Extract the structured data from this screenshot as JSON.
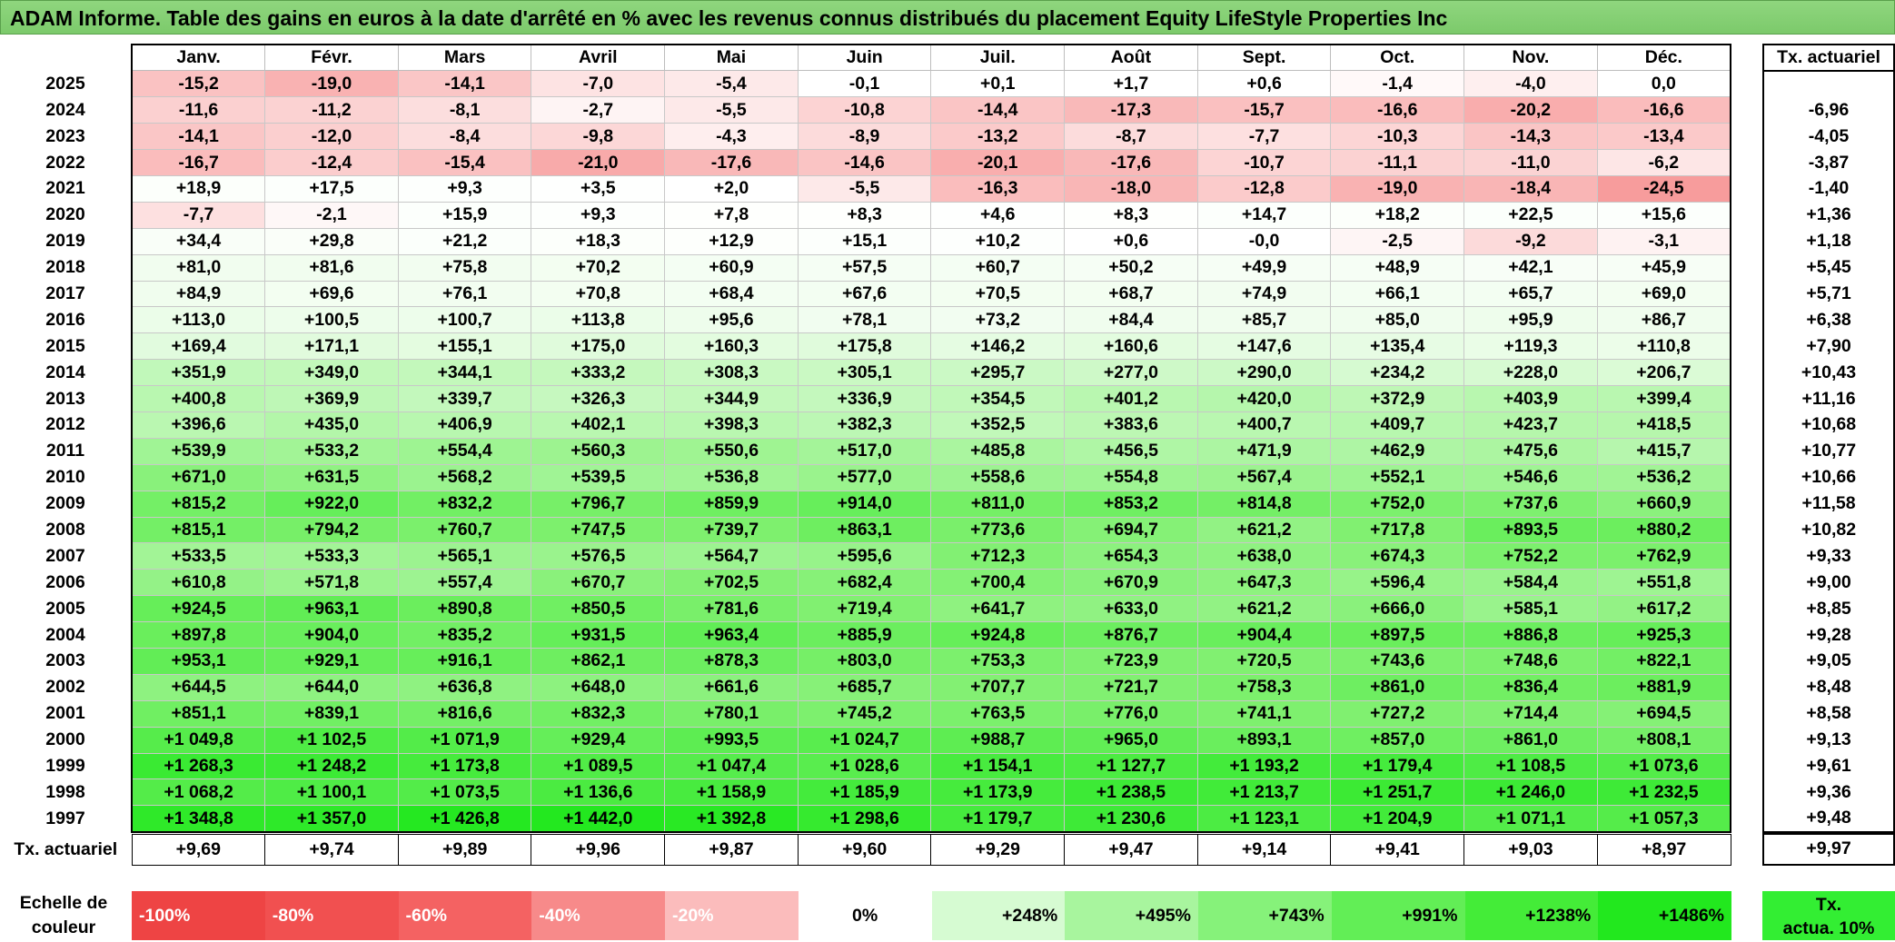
{
  "title": "ADAM Informe. Table des gains en euros à la date d'arrêté en % avec les revenus connus distribués du placement Equity LifeStyle Properties Inc",
  "months": [
    "Janv.",
    "Févr.",
    "Mars",
    "Avril",
    "Mai",
    "Juin",
    "Juil.",
    "Août",
    "Sept.",
    "Oct.",
    "Nov.",
    "Déc."
  ],
  "actuarial_header": "Tx. actuariel",
  "rows": [
    {
      "year": "2025",
      "values": [
        "-15,2",
        "-19,0",
        "-14,1",
        "-7,0",
        "-5,4",
        "-0,1",
        "+0,1",
        "+1,7",
        "+0,6",
        "-1,4",
        "-4,0",
        "0,0"
      ],
      "rate": ""
    },
    {
      "year": "2024",
      "values": [
        "-11,6",
        "-11,2",
        "-8,1",
        "-2,7",
        "-5,5",
        "-10,8",
        "-14,4",
        "-17,3",
        "-15,7",
        "-16,6",
        "-20,2",
        "-16,6"
      ],
      "rate": "-6,96"
    },
    {
      "year": "2023",
      "values": [
        "-14,1",
        "-12,0",
        "-8,4",
        "-9,8",
        "-4,3",
        "-8,9",
        "-13,2",
        "-8,7",
        "-7,7",
        "-10,3",
        "-14,3",
        "-13,4"
      ],
      "rate": "-4,05"
    },
    {
      "year": "2022",
      "values": [
        "-16,7",
        "-12,4",
        "-15,4",
        "-21,0",
        "-17,6",
        "-14,6",
        "-20,1",
        "-17,6",
        "-10,7",
        "-11,1",
        "-11,0",
        "-6,2"
      ],
      "rate": "-3,87"
    },
    {
      "year": "2021",
      "values": [
        "+18,9",
        "+17,5",
        "+9,3",
        "+3,5",
        "+2,0",
        "-5,5",
        "-16,3",
        "-18,0",
        "-12,8",
        "-19,0",
        "-18,4",
        "-24,5"
      ],
      "rate": "-1,40"
    },
    {
      "year": "2020",
      "values": [
        "-7,7",
        "-2,1",
        "+15,9",
        "+9,3",
        "+7,8",
        "+8,3",
        "+4,6",
        "+8,3",
        "+14,7",
        "+18,2",
        "+22,5",
        "+15,6"
      ],
      "rate": "+1,36"
    },
    {
      "year": "2019",
      "values": [
        "+34,4",
        "+29,8",
        "+21,2",
        "+18,3",
        "+12,9",
        "+15,1",
        "+10,2",
        "+0,6",
        "-0,0",
        "-2,5",
        "-9,2",
        "-3,1"
      ],
      "rate": "+1,18"
    },
    {
      "year": "2018",
      "values": [
        "+81,0",
        "+81,6",
        "+75,8",
        "+70,2",
        "+60,9",
        "+57,5",
        "+60,7",
        "+50,2",
        "+49,9",
        "+48,9",
        "+42,1",
        "+45,9"
      ],
      "rate": "+5,45"
    },
    {
      "year": "2017",
      "values": [
        "+84,9",
        "+69,6",
        "+76,1",
        "+70,8",
        "+68,4",
        "+67,6",
        "+70,5",
        "+68,7",
        "+74,9",
        "+66,1",
        "+65,7",
        "+69,0"
      ],
      "rate": "+5,71"
    },
    {
      "year": "2016",
      "values": [
        "+113,0",
        "+100,5",
        "+100,7",
        "+113,8",
        "+95,6",
        "+78,1",
        "+73,2",
        "+84,4",
        "+85,7",
        "+85,0",
        "+95,9",
        "+86,7"
      ],
      "rate": "+6,38"
    },
    {
      "year": "2015",
      "values": [
        "+169,4",
        "+171,1",
        "+155,1",
        "+175,0",
        "+160,3",
        "+175,8",
        "+146,2",
        "+160,6",
        "+147,6",
        "+135,4",
        "+119,3",
        "+110,8"
      ],
      "rate": "+7,90"
    },
    {
      "year": "2014",
      "values": [
        "+351,9",
        "+349,0",
        "+344,1",
        "+333,2",
        "+308,3",
        "+305,1",
        "+295,7",
        "+277,0",
        "+290,0",
        "+234,2",
        "+228,0",
        "+206,7"
      ],
      "rate": "+10,43"
    },
    {
      "year": "2013",
      "values": [
        "+400,8",
        "+369,9",
        "+339,7",
        "+326,3",
        "+344,9",
        "+336,9",
        "+354,5",
        "+401,2",
        "+420,0",
        "+372,9",
        "+403,9",
        "+399,4"
      ],
      "rate": "+11,16"
    },
    {
      "year": "2012",
      "values": [
        "+396,6",
        "+435,0",
        "+406,9",
        "+402,1",
        "+398,3",
        "+382,3",
        "+352,5",
        "+383,6",
        "+400,7",
        "+409,7",
        "+423,7",
        "+418,5"
      ],
      "rate": "+10,68"
    },
    {
      "year": "2011",
      "values": [
        "+539,9",
        "+533,2",
        "+554,4",
        "+560,3",
        "+550,6",
        "+517,0",
        "+485,8",
        "+456,5",
        "+471,9",
        "+462,9",
        "+475,6",
        "+415,7"
      ],
      "rate": "+10,77"
    },
    {
      "year": "2010",
      "values": [
        "+671,0",
        "+631,5",
        "+568,2",
        "+539,5",
        "+536,8",
        "+577,0",
        "+558,6",
        "+554,8",
        "+567,4",
        "+552,1",
        "+546,6",
        "+536,2"
      ],
      "rate": "+10,66"
    },
    {
      "year": "2009",
      "values": [
        "+815,2",
        "+922,0",
        "+832,2",
        "+796,7",
        "+859,9",
        "+914,0",
        "+811,0",
        "+853,2",
        "+814,8",
        "+752,0",
        "+737,6",
        "+660,9"
      ],
      "rate": "+11,58"
    },
    {
      "year": "2008",
      "values": [
        "+815,1",
        "+794,2",
        "+760,7",
        "+747,5",
        "+739,7",
        "+863,1",
        "+773,6",
        "+694,7",
        "+621,2",
        "+717,8",
        "+893,5",
        "+880,2"
      ],
      "rate": "+10,82"
    },
    {
      "year": "2007",
      "values": [
        "+533,5",
        "+533,3",
        "+565,1",
        "+576,5",
        "+564,7",
        "+595,6",
        "+712,3",
        "+654,3",
        "+638,0",
        "+674,3",
        "+752,2",
        "+762,9"
      ],
      "rate": "+9,33"
    },
    {
      "year": "2006",
      "values": [
        "+610,8",
        "+571,8",
        "+557,4",
        "+670,7",
        "+702,5",
        "+682,4",
        "+700,4",
        "+670,9",
        "+647,3",
        "+596,4",
        "+584,4",
        "+551,8"
      ],
      "rate": "+9,00"
    },
    {
      "year": "2005",
      "values": [
        "+924,5",
        "+963,1",
        "+890,8",
        "+850,5",
        "+781,6",
        "+719,4",
        "+641,7",
        "+633,0",
        "+621,2",
        "+666,0",
        "+585,1",
        "+617,2"
      ],
      "rate": "+8,85"
    },
    {
      "year": "2004",
      "values": [
        "+897,8",
        "+904,0",
        "+835,2",
        "+931,5",
        "+963,4",
        "+885,9",
        "+924,8",
        "+876,7",
        "+904,4",
        "+897,5",
        "+886,8",
        "+925,3"
      ],
      "rate": "+9,28"
    },
    {
      "year": "2003",
      "values": [
        "+953,1",
        "+929,1",
        "+916,1",
        "+862,1",
        "+878,3",
        "+803,0",
        "+753,3",
        "+723,9",
        "+720,5",
        "+743,6",
        "+748,6",
        "+822,1"
      ],
      "rate": "+9,05"
    },
    {
      "year": "2002",
      "values": [
        "+644,5",
        "+644,0",
        "+636,8",
        "+648,0",
        "+661,6",
        "+685,7",
        "+707,7",
        "+721,7",
        "+758,3",
        "+861,0",
        "+836,4",
        "+881,9"
      ],
      "rate": "+8,48"
    },
    {
      "year": "2001",
      "values": [
        "+851,1",
        "+839,1",
        "+816,6",
        "+832,3",
        "+780,1",
        "+745,2",
        "+763,5",
        "+776,0",
        "+741,1",
        "+727,2",
        "+714,4",
        "+694,5"
      ],
      "rate": "+8,58"
    },
    {
      "year": "2000",
      "values": [
        "+1 049,8",
        "+1 102,5",
        "+1 071,9",
        "+929,4",
        "+993,5",
        "+1 024,7",
        "+988,7",
        "+965,0",
        "+893,1",
        "+857,0",
        "+861,0",
        "+808,1"
      ],
      "rate": "+9,13"
    },
    {
      "year": "1999",
      "values": [
        "+1 268,3",
        "+1 248,2",
        "+1 173,8",
        "+1 089,5",
        "+1 047,4",
        "+1 028,6",
        "+1 154,1",
        "+1 127,7",
        "+1 193,2",
        "+1 179,4",
        "+1 108,5",
        "+1 073,6"
      ],
      "rate": "+9,61"
    },
    {
      "year": "1998",
      "values": [
        "+1 068,2",
        "+1 100,1",
        "+1 073,5",
        "+1 136,6",
        "+1 158,9",
        "+1 185,9",
        "+1 173,9",
        "+1 238,5",
        "+1 213,7",
        "+1 251,7",
        "+1 246,0",
        "+1 232,5"
      ],
      "rate": "+9,36"
    },
    {
      "year": "1997",
      "values": [
        "+1 348,8",
        "+1 357,0",
        "+1 426,8",
        "+1 442,0",
        "+1 392,8",
        "+1 298,6",
        "+1 179,7",
        "+1 230,6",
        "+1 123,1",
        "+1 204,9",
        "+1 071,1",
        "+1 057,3"
      ],
      "rate": "+9,48"
    }
  ],
  "totals": {
    "label": "Tx. actuariel",
    "values": [
      "+9,69",
      "+9,74",
      "+9,89",
      "+9,96",
      "+9,87",
      "+9,60",
      "+9,29",
      "+9,47",
      "+9,14",
      "+9,41",
      "+9,03",
      "+8,97"
    ],
    "overall": "+9,97"
  },
  "scale": {
    "label_line1": "Echelle de",
    "label_line2": "couleur",
    "items": [
      {
        "label": "-100%",
        "color": "#ee4444",
        "kind": "neg"
      },
      {
        "label": "-80%",
        "color": "#f15050",
        "kind": "neg"
      },
      {
        "label": "-60%",
        "color": "#f46262",
        "kind": "neg"
      },
      {
        "label": "-40%",
        "color": "#f78a8a",
        "kind": "neg"
      },
      {
        "label": "-20%",
        "color": "#fbbcbc",
        "kind": "neg"
      },
      {
        "label": "0%",
        "color": "#ffffff",
        "kind": "zero"
      },
      {
        "label": "+248%",
        "color": "#d6fbd2",
        "kind": "pos"
      },
      {
        "label": "+495%",
        "color": "#a8f59e",
        "kind": "pos"
      },
      {
        "label": "+743%",
        "color": "#86f27a",
        "kind": "pos"
      },
      {
        "label": "+991%",
        "color": "#62ee56",
        "kind": "pos"
      },
      {
        "label": "+1238%",
        "color": "#44ec38",
        "kind": "pos"
      },
      {
        "label": "+1486%",
        "color": "#22e81e",
        "kind": "pos"
      }
    ],
    "actuarial_line1": "Tx.",
    "actuarial_line2": "actua. 10%",
    "actuarial_color": "#33ee33"
  }
}
